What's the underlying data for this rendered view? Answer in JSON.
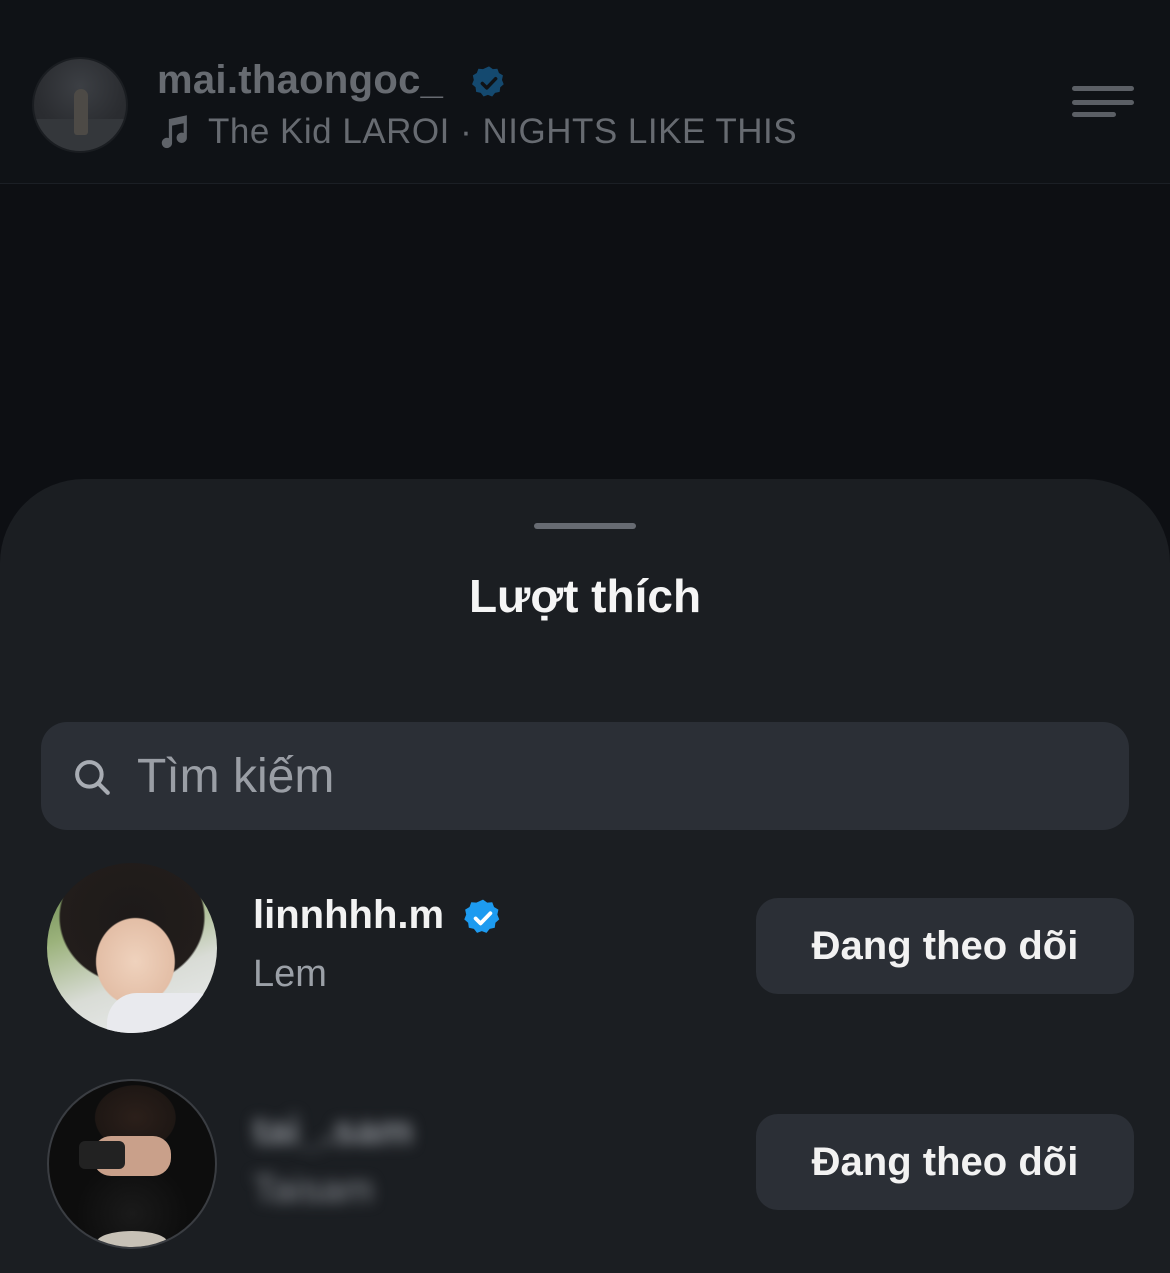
{
  "post_header": {
    "username": "mai.thaongoc_",
    "music": "The Kid LAROI · NIGHTS LIKE THIS",
    "icons": {
      "avatar": "profile-photo",
      "verified": "verified-badge-icon",
      "music": "music-note-icon",
      "menu": "menu-icon"
    }
  },
  "sheet": {
    "title": "Lượt thích",
    "search": {
      "placeholder": "Tìm kiếm",
      "value": "",
      "icon": "search-icon"
    },
    "users": [
      {
        "username": "linnhhh.m",
        "full_name": "Lem",
        "verified": true,
        "follow_label": "Đang theo dõi"
      },
      {
        "username": "tai_.sam",
        "full_name": "Taisam",
        "verified": false,
        "blurred": true,
        "follow_label": "Đang theo dõi"
      }
    ]
  },
  "colors": {
    "background": "#0d0f13",
    "sheet": "#1b1e22",
    "field": "#2b2f36",
    "verified": "#1d9bf0",
    "text_primary": "#f2f2f2",
    "text_secondary": "#9ba0a7"
  }
}
